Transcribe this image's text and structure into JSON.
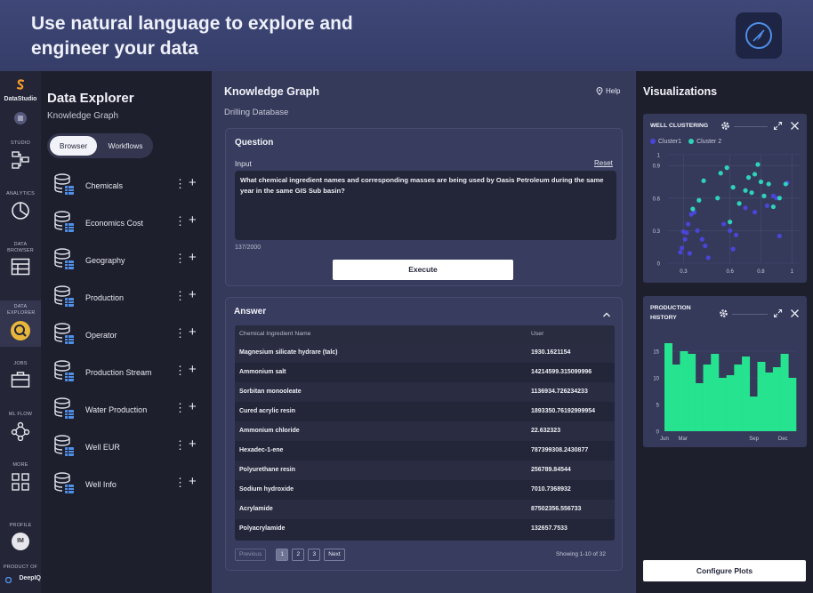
{
  "banner": {
    "title": "Use natural language to explore and engineer your data",
    "logo_icon": "compass-icon"
  },
  "rail": {
    "brand": "DataStudio",
    "items": [
      {
        "label": "STUDIO",
        "icon": "flow-icon"
      },
      {
        "label": "ANALYTICS",
        "icon": "pie-chart-icon"
      },
      {
        "label": "DATA BROWSER",
        "icon": "table-icon"
      },
      {
        "label": "DATA EXPLORER",
        "icon": "magnifier-icon"
      },
      {
        "label": "JOBS",
        "icon": "briefcase-icon"
      },
      {
        "label": "ML FLOW",
        "icon": "network-icon"
      },
      {
        "label": "MORE",
        "icon": "grid-icon"
      }
    ],
    "profile_label": "PROFILE",
    "avatar_initials": "IM",
    "product_of": "PRODUCT OF",
    "company": "DeepIQ"
  },
  "explorer": {
    "title": "Data Explorer",
    "subtitle": "Knowledge Graph",
    "tabs": [
      "Browser",
      "Workflows"
    ],
    "items": [
      "Chemicals",
      "Economics Cost",
      "Geography",
      "Production",
      "Operator",
      "Production Stream",
      "Water Production",
      "Well EUR",
      "Well Info"
    ]
  },
  "main": {
    "title": "Knowledge Graph",
    "help": "Help",
    "subtitle": "Drilling Database",
    "question": {
      "title": "Question",
      "input_label": "Input",
      "reset": "Reset",
      "value": "What chemical ingredient names and corresponding masses are being used by Oasis Petroleum during the same year in the same GIS Sub basin?",
      "count": "137/2000",
      "execute": "Execute"
    },
    "answer": {
      "title": "Answer",
      "columns": [
        "Chemical Ingredient Name",
        "User"
      ],
      "rows": [
        [
          "Magnesium silicate hydrare (talc)",
          "1930.1621154"
        ],
        [
          "Ammonium salt",
          "14214599.315099996"
        ],
        [
          "Sorbitan monooleate",
          "1136934.726234233"
        ],
        [
          "Cured acrylic resin",
          "1893350.76192999954"
        ],
        [
          "Ammonium chloride",
          "22.632323"
        ],
        [
          "Hexadec-1-ene",
          "787399308.2430877"
        ],
        [
          "Polyurethane resin",
          "256789.84544"
        ],
        [
          "Sodium hydroxide",
          "7010.7368932"
        ],
        [
          "Acrylamide",
          "87502356.556733"
        ],
        [
          "Polyacrylamide",
          "132657.7533"
        ]
      ],
      "pager": {
        "previous": "Previous",
        "pages": [
          "1",
          "2",
          "3"
        ],
        "next": "Next",
        "showing": "Showing 1-10 of 32"
      }
    }
  },
  "viz": {
    "title": "Visualizations",
    "configure": "Configure Plots",
    "colors": {
      "cluster1": "#4a45d8",
      "cluster2": "#2fd3b9",
      "bars": "#25e38e"
    }
  },
  "chart_data": [
    {
      "type": "scatter",
      "title": "WELL CLUSTERING",
      "series": [
        {
          "name": "Cluster1",
          "points": [
            [
              0.29,
              0.14
            ],
            [
              0.31,
              0.22
            ],
            [
              0.32,
              0.28
            ],
            [
              0.33,
              0.36
            ],
            [
              0.35,
              0.45
            ],
            [
              0.37,
              0.47
            ],
            [
              0.42,
              0.22
            ],
            [
              0.44,
              0.16
            ],
            [
              0.46,
              0.05
            ],
            [
              0.3,
              0.29
            ],
            [
              0.34,
              0.09
            ],
            [
              0.39,
              0.3
            ],
            [
              0.56,
              0.36
            ],
            [
              0.6,
              0.3
            ],
            [
              0.62,
              0.13
            ],
            [
              0.64,
              0.26
            ],
            [
              0.7,
              0.51
            ],
            [
              0.76,
              0.47
            ],
            [
              0.84,
              0.53
            ],
            [
              0.88,
              0.62
            ],
            [
              0.9,
              0.6
            ],
            [
              0.92,
              0.25
            ],
            [
              0.97,
              0.74
            ],
            [
              0.28,
              0.1
            ]
          ]
        },
        {
          "name": "Cluster 2",
          "points": [
            [
              0.36,
              0.5
            ],
            [
              0.4,
              0.58
            ],
            [
              0.43,
              0.76
            ],
            [
              0.54,
              0.83
            ],
            [
              0.58,
              0.88
            ],
            [
              0.6,
              0.38
            ],
            [
              0.66,
              0.55
            ],
            [
              0.7,
              0.67
            ],
            [
              0.72,
              0.79
            ],
            [
              0.76,
              0.82
            ],
            [
              0.78,
              0.91
            ],
            [
              0.8,
              0.75
            ],
            [
              0.82,
              0.62
            ],
            [
              0.85,
              0.73
            ],
            [
              0.88,
              0.52
            ],
            [
              0.92,
              0.6
            ],
            [
              0.96,
              0.73
            ],
            [
              0.52,
              0.6
            ],
            [
              0.62,
              0.7
            ],
            [
              0.74,
              0.65
            ]
          ]
        }
      ],
      "x_ticks": [
        "0.3",
        "0.6",
        "0.8",
        "1"
      ],
      "y_ticks": [
        "0",
        "0.3",
        "0.6",
        "0.9",
        "1"
      ],
      "xlim": [
        0.2,
        1.05
      ],
      "ylim": [
        0,
        1
      ],
      "grid": true
    },
    {
      "type": "bar",
      "title": "PRODUCTION HISTORY",
      "values": [
        16.5,
        12.5,
        15,
        14.5,
        9,
        12.5,
        14.5,
        10,
        10.5,
        12.5,
        14,
        6.5,
        13,
        11,
        12,
        14.5,
        10
      ],
      "x_ticks": [
        "Jun",
        "Mar",
        "Sep",
        "Dec"
      ],
      "y_ticks": [
        "0",
        "5",
        "10",
        "15"
      ],
      "ylim": [
        0,
        18
      ]
    }
  ]
}
